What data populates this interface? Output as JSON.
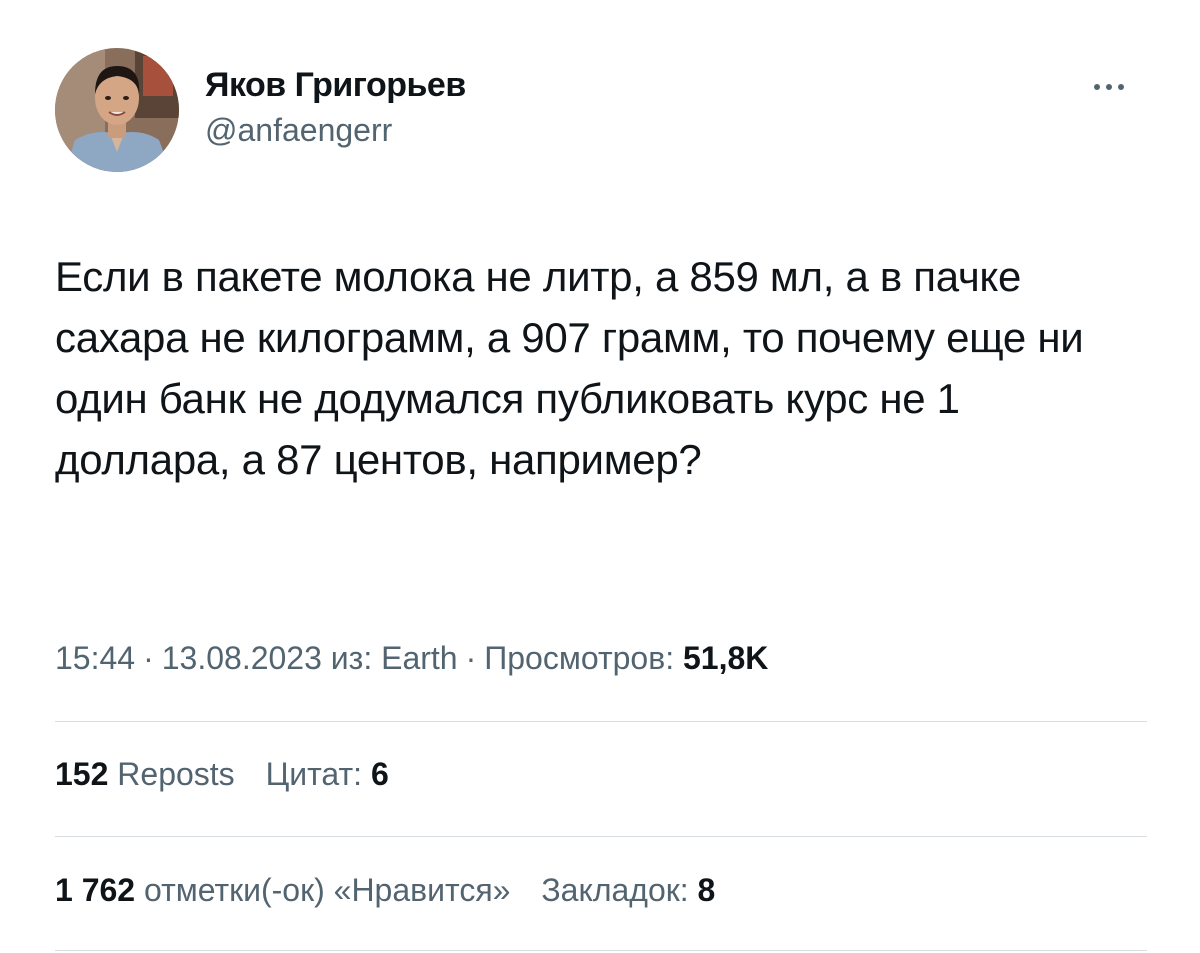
{
  "author": {
    "display_name": "Яков Григорьев",
    "handle": "@anfaengerr"
  },
  "tweet": {
    "text": "Если в пакете молока не литр, а 859 мл, а в пачке сахара не килограмм, а 907 грамм, то почему еще ни один банк не додумался публиковать курс не 1 доллара, а 87 центов, например?"
  },
  "meta": {
    "time": "15:44",
    "date": "13.08.2023",
    "source_prefix": "из:",
    "source": "Earth",
    "views_label": "Просмотров:",
    "views_count": "51,8K",
    "separator": "·"
  },
  "stats": {
    "reposts_count": "152",
    "reposts_label": "Reposts",
    "quotes_label": "Цитат:",
    "quotes_count": "6",
    "likes_count": "1 762",
    "likes_label": "отметки(-ок) «Нравится»",
    "bookmarks_label": "Закладок:",
    "bookmarks_count": "8"
  },
  "icons": {
    "more": "more-horizontal-icon",
    "avatar": "profile-photo"
  },
  "colors": {
    "text_primary": "#0f1419",
    "text_secondary": "#536471",
    "divider": "#d8dde1"
  }
}
